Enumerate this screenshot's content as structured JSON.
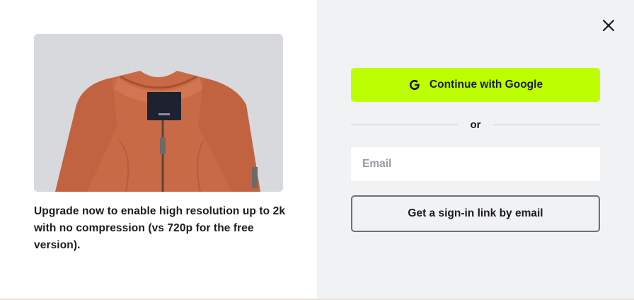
{
  "left_panel": {
    "product_image_alt": "",
    "upgrade_text": "Upgrade now to enable high resolution up to 2k with no compression (vs 720p for the free version)."
  },
  "right_panel": {
    "close_icon": "close-icon",
    "google_button": {
      "label": "Continue with Google",
      "icon": "google-icon",
      "background": "#beff00"
    },
    "divider_text": "or",
    "email_input": {
      "placeholder": "Email",
      "value": ""
    },
    "signin_link_button": {
      "label": "Get a sign-in link by email"
    }
  },
  "colors": {
    "accent": "#beff00",
    "right_panel_bg": "#f1f2f4",
    "text": "#1b1b1f",
    "placeholder": "#9a9ca6"
  }
}
